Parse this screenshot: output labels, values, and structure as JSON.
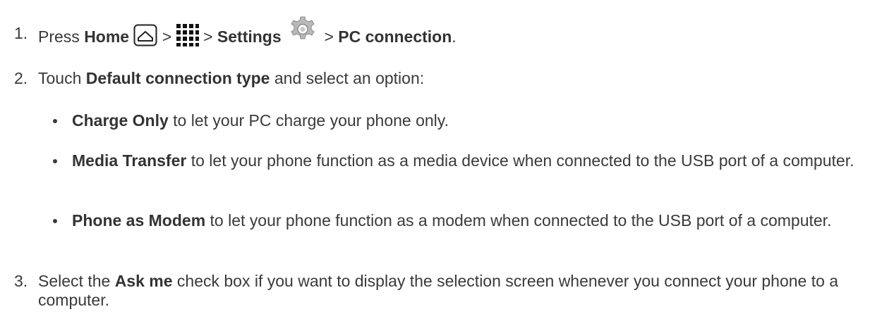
{
  "steps": [
    {
      "number": "1.",
      "parts": {
        "press": "Press",
        "home": "Home",
        "sep1": ">",
        "sep2": ">",
        "settings": "Settings",
        "sep3": ">",
        "pc_connection": "PC connection",
        "end": "."
      },
      "icons": [
        "home-icon",
        "apps-grid-icon",
        "settings-gear-icon"
      ]
    },
    {
      "number": "2.",
      "parts": {
        "touch": "Touch",
        "default_connection_type": "Default connection type",
        "rest": "and select an option:"
      }
    },
    {
      "number": "3.",
      "parts": {
        "select_the": "Select the",
        "ask_me": "Ask me",
        "rest": "check box if you want to display the selection screen whenever you connect your phone to a computer."
      }
    }
  ],
  "options": [
    {
      "label": "Charge Only",
      "description": "to let your PC charge your phone only."
    },
    {
      "label": "Media Transfer",
      "description": "to let your phone function as a media device when connected to the USB port of a computer."
    },
    {
      "label": "Phone as Modem",
      "description": "to let your phone function as a modem when connected to the USB port of a computer."
    }
  ]
}
